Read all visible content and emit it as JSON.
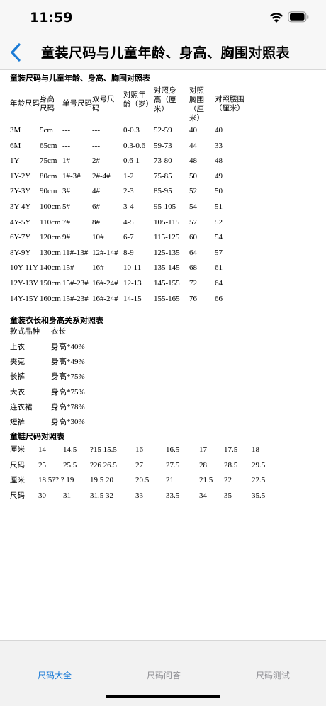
{
  "status_bar": {
    "time": "11:59"
  },
  "nav": {
    "title": "童装尺码与儿童年龄、身高、胸围对照表"
  },
  "table1": {
    "title": "童装尺码与儿童年龄、身高、胸围对照表",
    "headers": [
      "年龄尺码",
      "身高尺码",
      "单号尺码",
      "双号尺码",
      "对照年龄（岁）",
      "对照身高（厘米）",
      "对照胸围（厘米）",
      "对照腰围（厘米）"
    ],
    "rows": [
      [
        "3M",
        "5cm",
        "---",
        "---",
        "0-0.3",
        "52-59",
        "40",
        "40"
      ],
      [
        "6M",
        "65cm",
        "---",
        "---",
        "0.3-0.6",
        "59-73",
        "44",
        "33"
      ],
      [
        "1Y",
        "75cm",
        "1#",
        "2#",
        "0.6-1",
        "73-80",
        "48",
        "48"
      ],
      [
        "1Y-2Y",
        "80cm",
        "1#-3#",
        "2#-4#",
        "1-2",
        "75-85",
        "50",
        "49"
      ],
      [
        "2Y-3Y",
        "90cm",
        "3#",
        "4#",
        "2-3",
        "85-95",
        "52",
        "50"
      ],
      [
        "3Y-4Y",
        "100cm",
        "5#",
        "6#",
        "3-4",
        "95-105",
        "54",
        "51"
      ],
      [
        "4Y-5Y",
        "110cm",
        "7#",
        "8#",
        "4-5",
        "105-115",
        "57",
        "52"
      ],
      [
        "6Y-7Y",
        "120cm",
        "9#",
        "10#",
        "6-7",
        "115-125",
        "60",
        "54"
      ],
      [
        "8Y-9Y",
        "130cm",
        "11#-13#",
        "12#-14#",
        "8-9",
        "125-135",
        "64",
        "57"
      ],
      [
        "10Y-11Y",
        "140cm",
        "15#",
        "16#",
        "10-11",
        "135-145",
        "68",
        "61"
      ],
      [
        "12Y-13Y",
        "150cm",
        "15#-23#",
        "16#-24#",
        "12-13",
        "145-155",
        "72",
        "64"
      ],
      [
        "14Y-15Y",
        "160cm",
        "15#-23#",
        "16#-24#",
        "14-15",
        "155-165",
        "76",
        "66"
      ]
    ]
  },
  "table2": {
    "title": "童装衣长和身高关系对照表",
    "headers": [
      "款式品种",
      "衣长"
    ],
    "rows": [
      [
        "上衣",
        "身高*40%"
      ],
      [
        "夹克",
        "身高*49%"
      ],
      [
        "长裤",
        "身高*75%"
      ],
      [
        "大衣",
        "身高*75%"
      ],
      [
        "连衣裙",
        "身高*78%"
      ],
      [
        "短裤",
        "身高*30%"
      ]
    ]
  },
  "table3": {
    "title": "童鞋尺码对照表",
    "rows": [
      [
        "厘米",
        "14",
        "14.5",
        "?15  15.5",
        "16",
        "16.5",
        "17",
        "17.5",
        "18"
      ],
      [
        "尺码",
        "25",
        "25.5",
        "?26  26.5",
        "27",
        "27.5",
        "28",
        "28.5",
        "29.5"
      ],
      [
        "厘米",
        "18.5?? ? 19",
        "",
        "19.5  20",
        "20.5",
        "21",
        "21.5",
        "22",
        "22.5"
      ],
      [
        "尺码",
        "30",
        "31",
        "31.5  32",
        "33",
        "33.5",
        "34",
        "35",
        "35.5"
      ]
    ]
  },
  "tabs": [
    "尺码大全",
    "尺码问答",
    "尺码测试"
  ],
  "colors": {
    "accent": "#1a7bd6",
    "inactive": "#8e8e93",
    "bar_bg": "#f7f7f7"
  }
}
